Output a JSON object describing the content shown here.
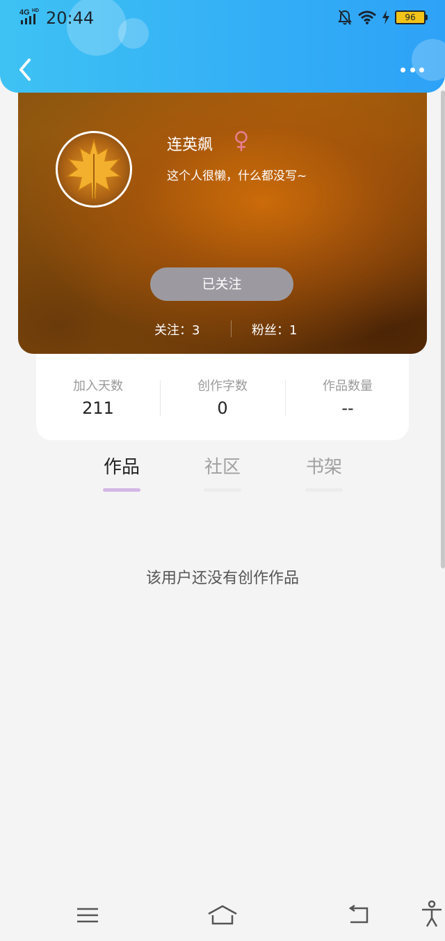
{
  "status_bar": {
    "time": "20:44",
    "network": "4G HD",
    "battery": "96",
    "icons": [
      "signal-icon",
      "bell-muted-icon",
      "wifi-icon",
      "charging-icon",
      "battery-icon"
    ]
  },
  "nav": {
    "back_icon": "back-chevron-icon",
    "more_icon": "more-dots-icon"
  },
  "profile": {
    "name": "连英飙",
    "gender_icon": "female-icon",
    "bio": "这个人很懒，什么都没写~",
    "follow_button": "已关注",
    "following_text": "关注：3",
    "fans_text": "粉丝：1"
  },
  "stats": [
    {
      "label": "加入天数",
      "value": "211"
    },
    {
      "label": "创作字数",
      "value": "0"
    },
    {
      "label": "作品数量",
      "value": "--"
    }
  ],
  "tabs": [
    {
      "label": "作品",
      "active": true
    },
    {
      "label": "社区",
      "active": false
    },
    {
      "label": "书架",
      "active": false
    }
  ],
  "empty_message": "该用户还没有创作作品",
  "colors": {
    "header": "#33aef6",
    "tab_active_underline": "#d4b6e6",
    "tab_inactive_underline": "#ececec",
    "female_icon": "#e87f92"
  },
  "bottom_nav": [
    "menu-icon",
    "home-icon",
    "back-icon",
    "accessibility-icon"
  ]
}
